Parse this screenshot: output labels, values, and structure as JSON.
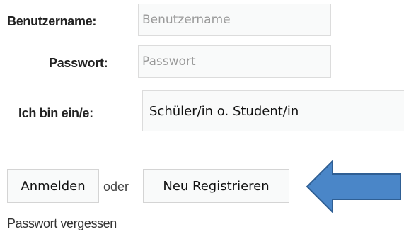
{
  "login_form": {
    "username_label": "Benutzername:",
    "username_placeholder": "Benutzername",
    "password_label": "Passwort:",
    "password_placeholder": "Passwort",
    "role_label": "Ich bin ein/e:",
    "role_selected": "Schüler/in o. Student/in",
    "login_button": "Anmelden",
    "or_text": "oder",
    "register_button": "Neu Registrieren",
    "forgot_password_link": "Passwort vergessen"
  },
  "colors": {
    "arrow_fill": "#4a86c8",
    "arrow_stroke": "#2f5f94",
    "input_background": "#f9fafa",
    "input_border": "#dcdcdc"
  },
  "icons": {
    "arrow": "left-pointing-arrow"
  }
}
